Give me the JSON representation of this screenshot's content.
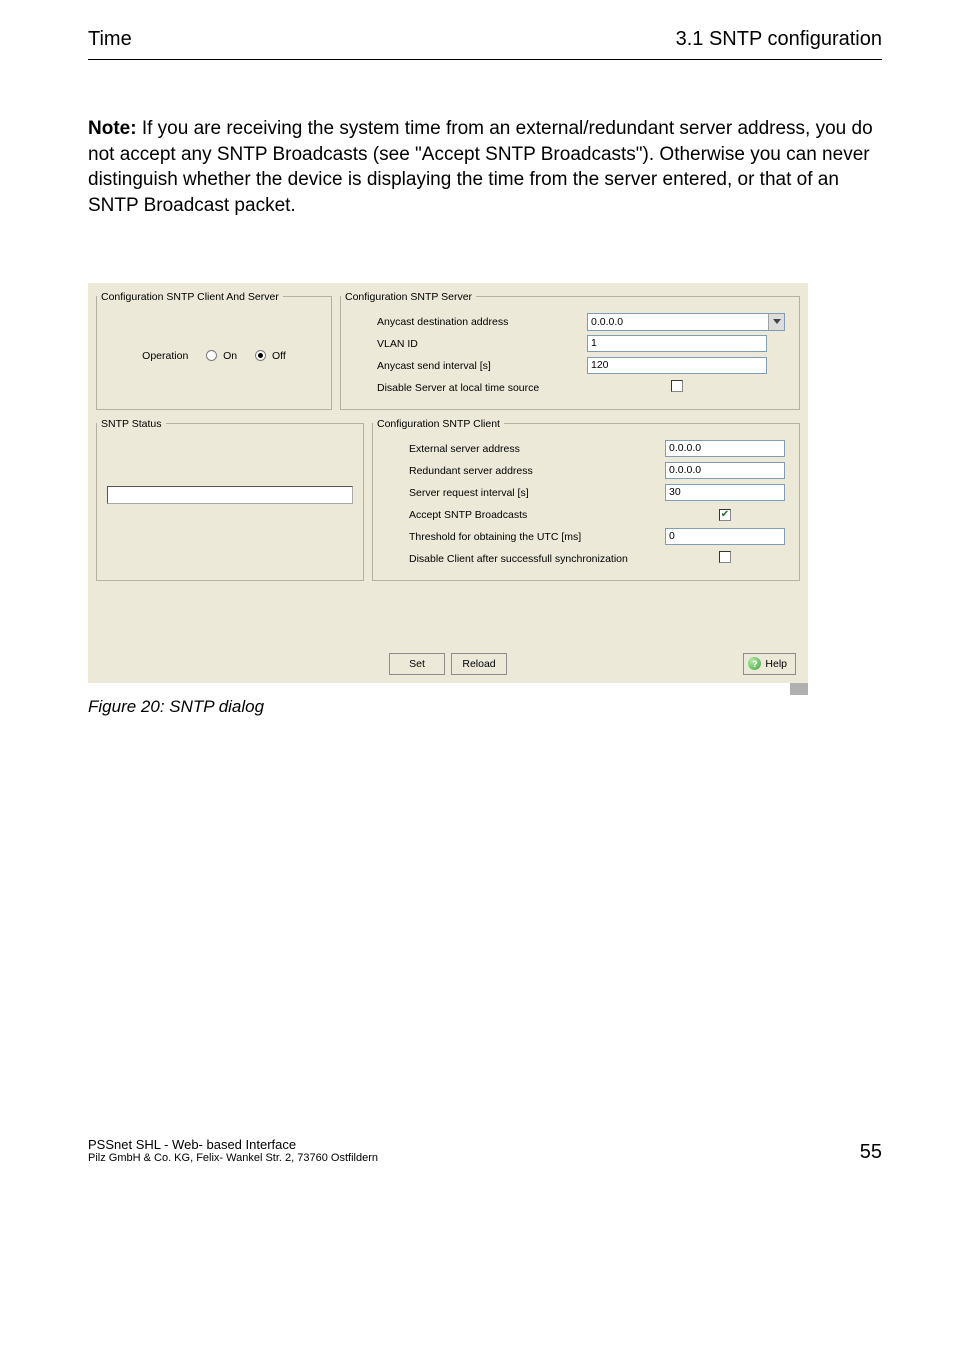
{
  "header": {
    "left": "Time",
    "right": "3.1 SNTP configuration"
  },
  "note": {
    "label": "Note:",
    "text": " If you are receiving the system time from an external/redundant server address, you do not accept any SNTP Broadcasts (see \"Accept SNTP Broadcasts\"). Otherwise you can never distinguish whether the device is displaying the time from the server entered, or that of an SNTP Broadcast packet."
  },
  "dialog": {
    "group_client_server": "Configuration SNTP Client And Server",
    "operation_label": "Operation",
    "operation_on": "On",
    "operation_off": "Off",
    "group_server": "Configuration SNTP Server",
    "server": {
      "anycast_addr_label": "Anycast destination address",
      "anycast_addr_value": "0.0.0.0",
      "vlan_label": "VLAN ID",
      "vlan_value": "1",
      "send_interval_label": "Anycast send interval [s]",
      "send_interval_value": "120",
      "disable_local_label": "Disable Server at local time source"
    },
    "group_status": "SNTP Status",
    "group_client": "Configuration SNTP Client",
    "client": {
      "ext_addr_label": "External server address",
      "ext_addr_value": "0.0.0.0",
      "red_addr_label": "Redundant server address",
      "red_addr_value": "0.0.0.0",
      "req_interval_label": "Server request interval [s]",
      "req_interval_value": "30",
      "accept_label": "Accept SNTP Broadcasts",
      "threshold_label": "Threshold for obtaining the UTC [ms]",
      "threshold_value": "0",
      "disable_after_label": "Disable Client after successfull synchronization"
    },
    "buttons": {
      "set": "Set",
      "reload": "Reload",
      "help": "Help"
    }
  },
  "figcap": "Figure 20: SNTP dialog",
  "footer": {
    "line1": "PSSnet SHL - Web- based Interface",
    "line2": "Pilz GmbH & Co. KG, Felix- Wankel Str. 2, 73760 Ostfildern",
    "page": "55"
  }
}
